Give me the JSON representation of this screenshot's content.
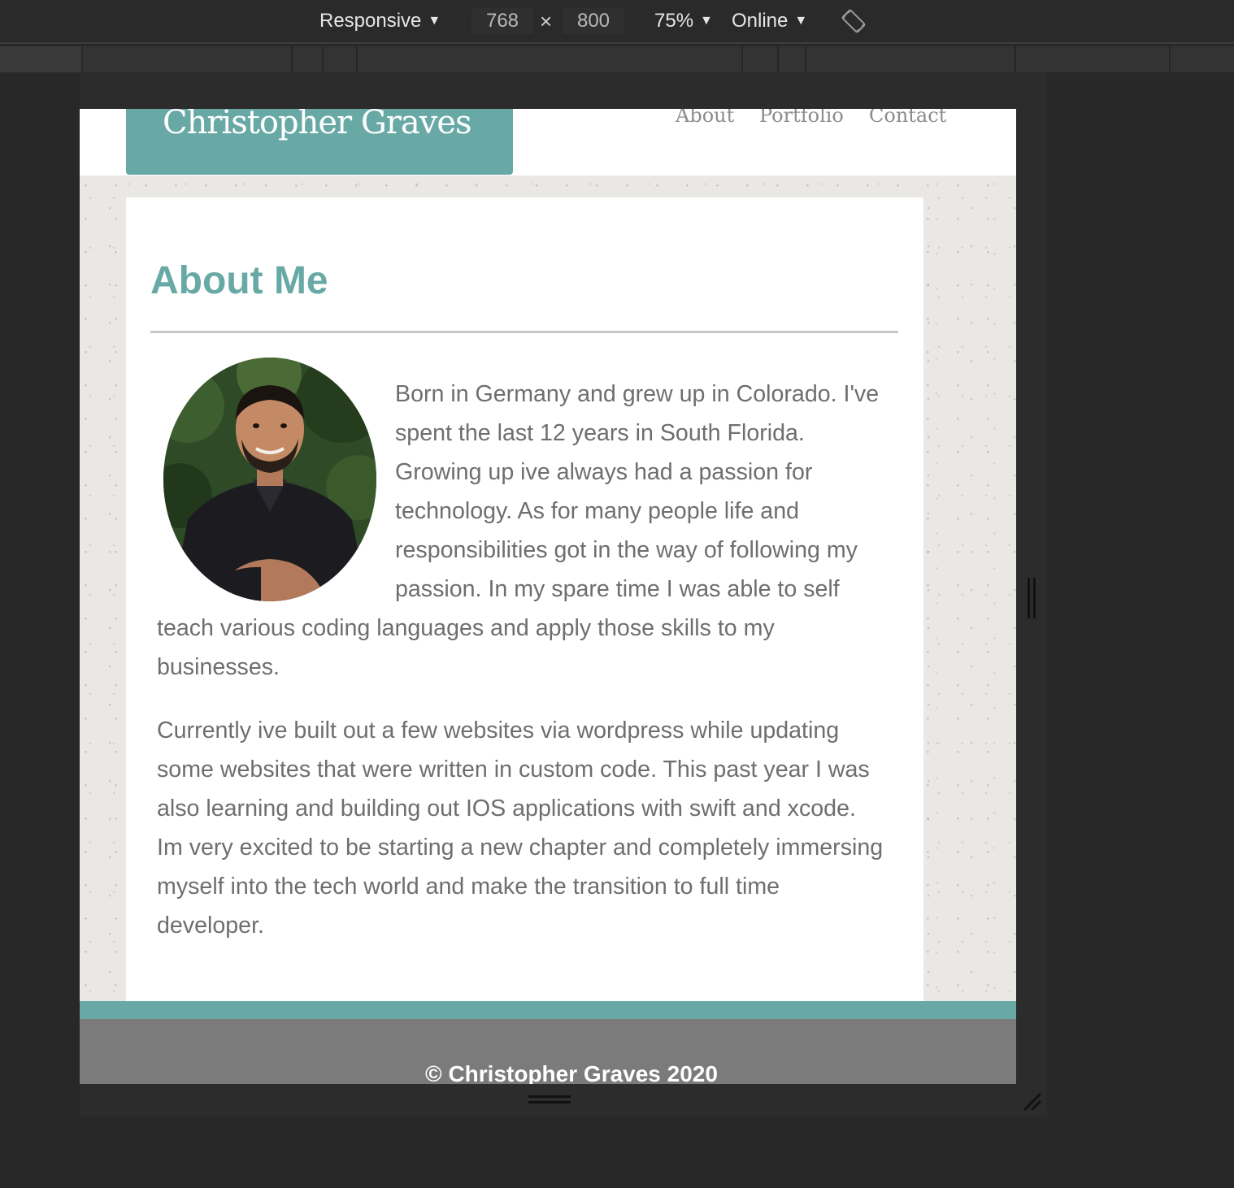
{
  "devtools": {
    "device": "Responsive",
    "width": "768",
    "times": "×",
    "height": "800",
    "zoom": "75%",
    "throttle": "Online",
    "rotate_icon": "rotate-icon"
  },
  "site": {
    "brand": "Christopher Graves",
    "nav": [
      "About",
      "Portfolio",
      "Contact"
    ],
    "heading": "About Me",
    "paragraphs": [
      "Born in Germany and grew up in Colorado. I've spent the last 12 years in South Florida. Growing up ive always had a passion for technology. As for many people life and responsibilities got in the way of following my passion. In my spare time I was able to self teach various coding languages and apply those skills to my businesses.",
      "Currently ive built out a few websites via wordpress while updating some websites that were written in custom code. This past year I was also learning and building out IOS applications with swift and xcode. Im very excited to be starting a new chapter and completely immersing myself into the tech world and make the transition to full time developer."
    ],
    "footer": "© Christopher Graves 2020"
  },
  "colors": {
    "accent": "#68a9a6",
    "footer": "#7b7b7b",
    "text": "#6e6e6e",
    "toolbar": "#2a2a2a"
  }
}
